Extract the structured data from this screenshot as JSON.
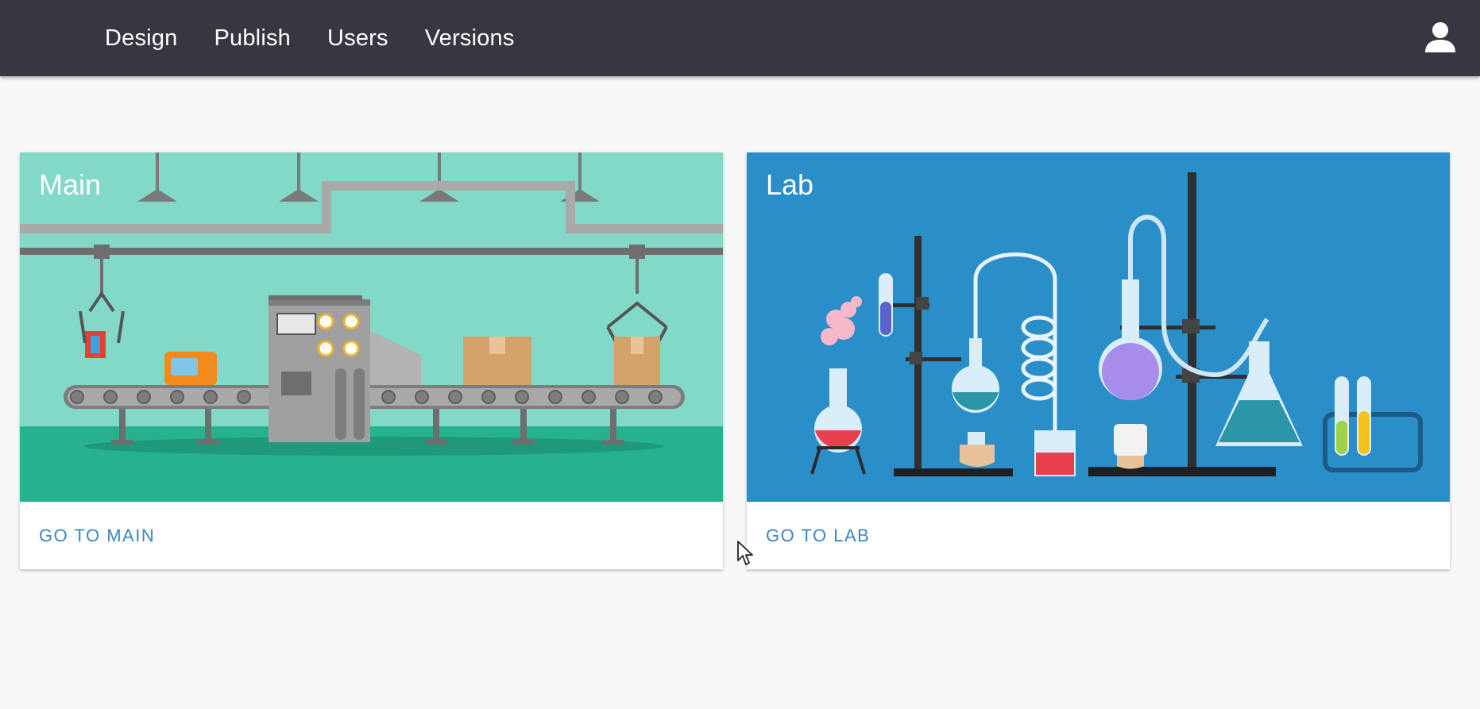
{
  "nav": {
    "items": [
      {
        "label": "Design"
      },
      {
        "label": "Publish"
      },
      {
        "label": "Users"
      },
      {
        "label": "Versions"
      }
    ],
    "account_icon": "account-icon"
  },
  "cards": [
    {
      "title": "Main",
      "action": "GO TO MAIN",
      "background": "#82d9c8"
    },
    {
      "title": "Lab",
      "action": "GO TO LAB",
      "background": "#2a8ec9"
    }
  ],
  "colors": {
    "appbar": "#373641",
    "page": "#f8f8f8",
    "accent": "#3b86c4"
  }
}
